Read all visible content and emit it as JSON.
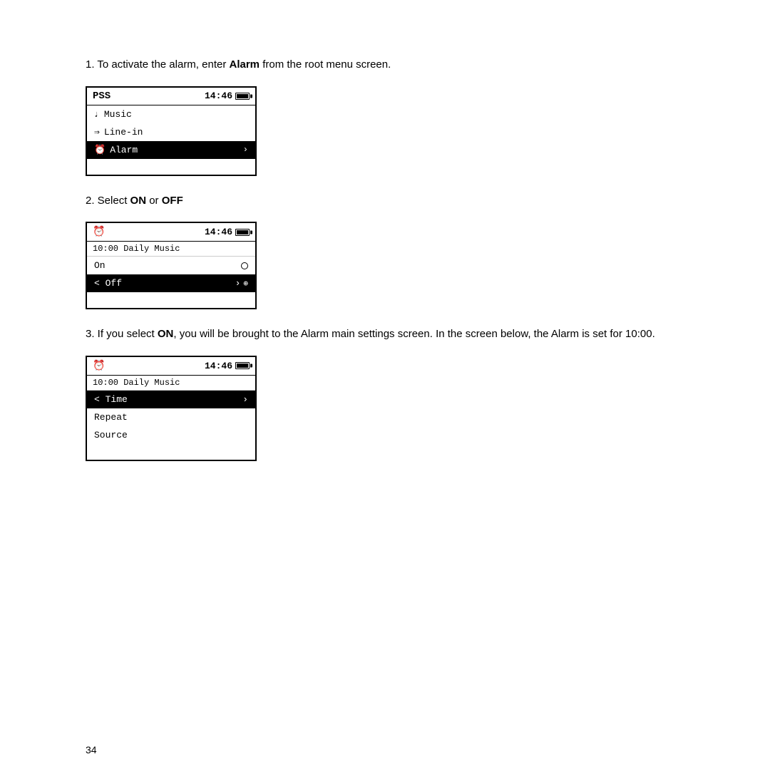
{
  "page": {
    "number": "34"
  },
  "steps": [
    {
      "id": "step1",
      "text_before": "1.  To activate the alarm, enter ",
      "bold": "Alarm",
      "text_after": " from the root menu screen.",
      "screen": {
        "header_left": "PSS",
        "header_time": "14:46",
        "items": [
          {
            "icon": "♩",
            "label": "Music",
            "selected": false,
            "arrow": ""
          },
          {
            "icon": "⇒",
            "label": "Line-in",
            "selected": false,
            "arrow": ""
          },
          {
            "icon": "⏰",
            "label": "Alarm",
            "selected": true,
            "arrow": "›"
          }
        ],
        "empty_rows": 1
      }
    },
    {
      "id": "step2",
      "text_before": "2. Select ",
      "bold1": "ON",
      "text_middle": " or ",
      "bold2": "OFF",
      "screen": {
        "header_left": "⏰",
        "header_time": "14:46",
        "subheader": "10:00  Daily  Music",
        "items": [
          {
            "label": "On",
            "selected": false,
            "radio": true
          },
          {
            "label": "Off",
            "selected": true,
            "arrow_left": "‹",
            "has_settings": true
          }
        ],
        "empty_rows": 1
      }
    },
    {
      "id": "step3",
      "text_before": "3. If you select ",
      "bold": "ON",
      "text_after": ", you will be brought to the Alarm main settings screen. In the screen below, the Alarm is set for 10:00.",
      "screen": {
        "header_left": "⏰",
        "header_time": "14:46",
        "subheader": "10:00  Daily  Music",
        "items": [
          {
            "label": "Time",
            "selected": true,
            "arrow_left": "‹",
            "arrow_right": "›"
          },
          {
            "label": "Repeat",
            "selected": false
          },
          {
            "label": "Source",
            "selected": false
          }
        ],
        "empty_rows": 1
      }
    }
  ],
  "labels": {
    "step1_pre": "1.  To activate the alarm, enter ",
    "step1_bold": "Alarm",
    "step1_post": " from the root menu screen.",
    "step2_pre": "2. Select ",
    "step2_bold1": "ON",
    "step2_mid": " or ",
    "step2_bold2": "OFF",
    "step3_pre": "3. If you select ",
    "step3_bold": "ON",
    "step3_post": ", you will be brought to the Alarm main settings screen. In the screen\n    below, the Alarm is set for 10:00.",
    "screen1_title": "PSS",
    "screen1_time": "14:46",
    "screen1_item1": "Music",
    "screen1_item2": "Line-in",
    "screen1_item3": "Alarm",
    "screen2_title": "⏰",
    "screen2_time": "14:46",
    "screen2_sub": "10:00  Daily  Music",
    "screen2_item1": "On",
    "screen2_item2": "< Off",
    "screen3_title": "⏰",
    "screen3_time": "14:46",
    "screen3_sub": "10:00  Daily  Music",
    "screen3_item1": "< Time",
    "screen3_item2": "Repeat",
    "screen3_item3": "Source"
  }
}
